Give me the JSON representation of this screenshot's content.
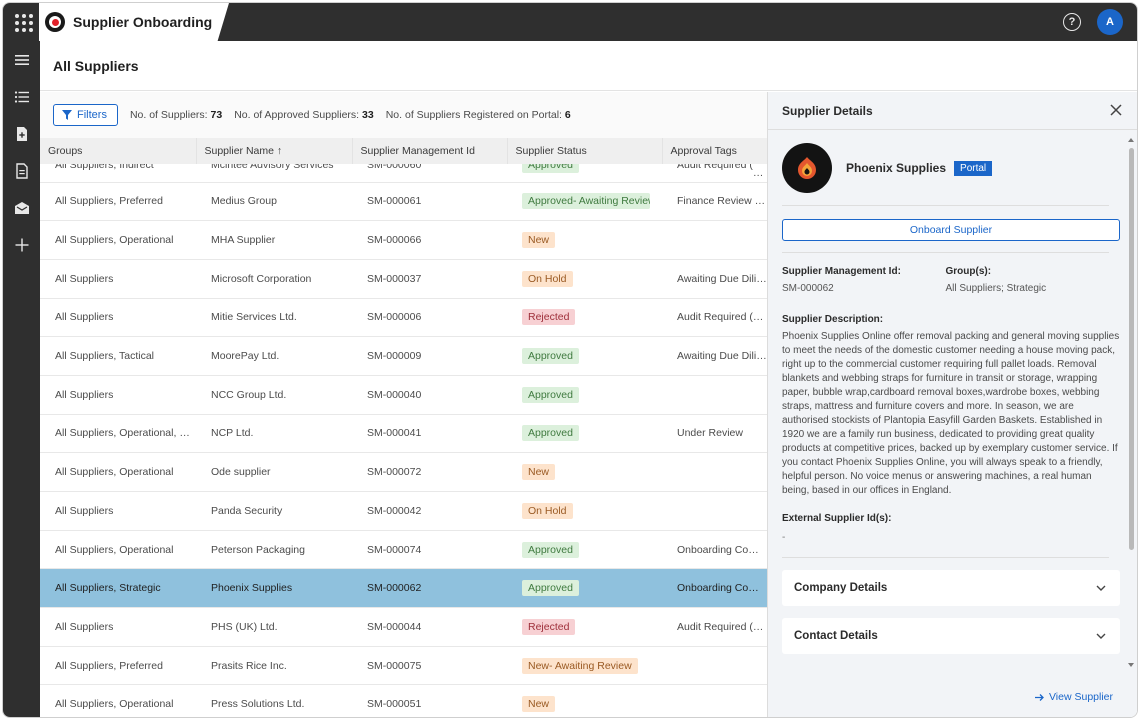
{
  "app": {
    "title": "Supplier Onboarding",
    "avatar_initial": "A"
  },
  "page": {
    "title": "All Suppliers"
  },
  "toolbar": {
    "filters_label": "Filters",
    "stats": [
      {
        "label": "No. of Suppliers:",
        "value": "73"
      },
      {
        "label": "No. of Approved Suppliers:",
        "value": "33"
      },
      {
        "label": "No. of Suppliers Registered on Portal:",
        "value": "6"
      }
    ]
  },
  "table": {
    "columns": [
      "Groups",
      "Supplier Name",
      "Supplier Management Id",
      "Supplier Status",
      "Approval Tags"
    ],
    "sort_indicator": "↑",
    "rows": [
      {
        "group": "All Suppliers, Indirect",
        "name": "Mcintee Advisory Services",
        "id": "SM-000060",
        "status": "Approved",
        "status_type": "approved",
        "tag": "Audit Required (on site)",
        "partial": true
      },
      {
        "group": "All Suppliers, Preferred",
        "name": "Medius Group",
        "id": "SM-000061",
        "status": "Approved- Awaiting Review",
        "status_type": "approved",
        "tag": "Finance Review Required"
      },
      {
        "group": "All Suppliers, Operational",
        "name": "MHA Supplier",
        "id": "SM-000066",
        "status": "New",
        "status_type": "new",
        "tag": ""
      },
      {
        "group": "All Suppliers",
        "name": "Microsoft Corporation",
        "id": "SM-000037",
        "status": "On Hold",
        "status_type": "hold",
        "tag": "Awaiting Due Diligence"
      },
      {
        "group": "All Suppliers",
        "name": "Mitie Services Ltd.",
        "id": "SM-000006",
        "status": "Rejected",
        "status_type": "rejected",
        "tag": "Audit Required (on site)"
      },
      {
        "group": "All Suppliers, Tactical",
        "name": "MoorePay Ltd.",
        "id": "SM-000009",
        "status": "Approved",
        "status_type": "approved",
        "tag": "Awaiting Due Diligence"
      },
      {
        "group": "All Suppliers",
        "name": "NCC Group Ltd.",
        "id": "SM-000040",
        "status": "Approved",
        "status_type": "approved",
        "tag": ""
      },
      {
        "group": "All Suppliers, Operational, Preferred",
        "name": "NCP Ltd.",
        "id": "SM-000041",
        "status": "Approved",
        "status_type": "approved",
        "tag": "Under Review"
      },
      {
        "group": "All Suppliers, Operational",
        "name": "Ode supplier",
        "id": "SM-000072",
        "status": "New",
        "status_type": "new",
        "tag": ""
      },
      {
        "group": "All Suppliers",
        "name": "Panda Security",
        "id": "SM-000042",
        "status": "On Hold",
        "status_type": "hold",
        "tag": ""
      },
      {
        "group": "All Suppliers, Operational",
        "name": "Peterson Packaging",
        "id": "SM-000074",
        "status": "Approved",
        "status_type": "approved",
        "tag": "Onboarding Complete"
      },
      {
        "group": "All Suppliers, Strategic",
        "name": "Phoenix Supplies",
        "id": "SM-000062",
        "status": "Approved",
        "status_type": "approved",
        "tag": "Onboarding Complete",
        "selected": true
      },
      {
        "group": "All Suppliers",
        "name": "PHS (UK) Ltd.",
        "id": "SM-000044",
        "status": "Rejected",
        "status_type": "rejected",
        "tag": "Audit Required (online)"
      },
      {
        "group": "All Suppliers, Preferred",
        "name": "Prasits Rice Inc.",
        "id": "SM-000075",
        "status": "New- Awaiting Review",
        "status_type": "new",
        "tag": ""
      },
      {
        "group": "All Suppliers, Operational",
        "name": "Press Solutions Ltd.",
        "id": "SM-000051",
        "status": "New",
        "status_type": "new",
        "tag": ""
      }
    ]
  },
  "details": {
    "header": "Supplier Details",
    "supplier_name": "Phoenix Supplies",
    "portal_badge": "Portal",
    "onboard_button": "Onboard Supplier",
    "mgmt_id_label": "Supplier Management Id:",
    "mgmt_id_value": "SM-000062",
    "groups_label": "Group(s):",
    "groups_value": "All Suppliers; Strategic",
    "description_label": "Supplier Description:",
    "description": "Phoenix Supplies Online offer removal packing and general moving supplies to meet the needs of the domestic customer needing a house moving pack, right up to the commercial customer requiring full pallet loads. Removal blankets and webbing straps for furniture in transit or storage, wrapping paper, bubble wrap,cardboard removal boxes,wardrobe boxes, webbing straps, mattress and furniture covers and more. In season, we are authorised stockists of Plantopia Easyfill Garden Baskets. Established in 1920 we are a family run business, dedicated to providing great quality products at competitive prices, backed up by exemplary customer service. If you contact Phoenix Supplies Online, you will always speak to a friendly, helpful person. No voice menus or answering machines, a real human being, based in our offices in England.",
    "external_label": "External Supplier Id(s):",
    "external_value": "-",
    "sections": [
      "Company Details",
      "Contact Details"
    ],
    "view_link": "View Supplier"
  },
  "colors": {
    "accent": "#1b66c9",
    "selected_row": "#8fc1dd",
    "topbar": "#2f2f2f"
  }
}
